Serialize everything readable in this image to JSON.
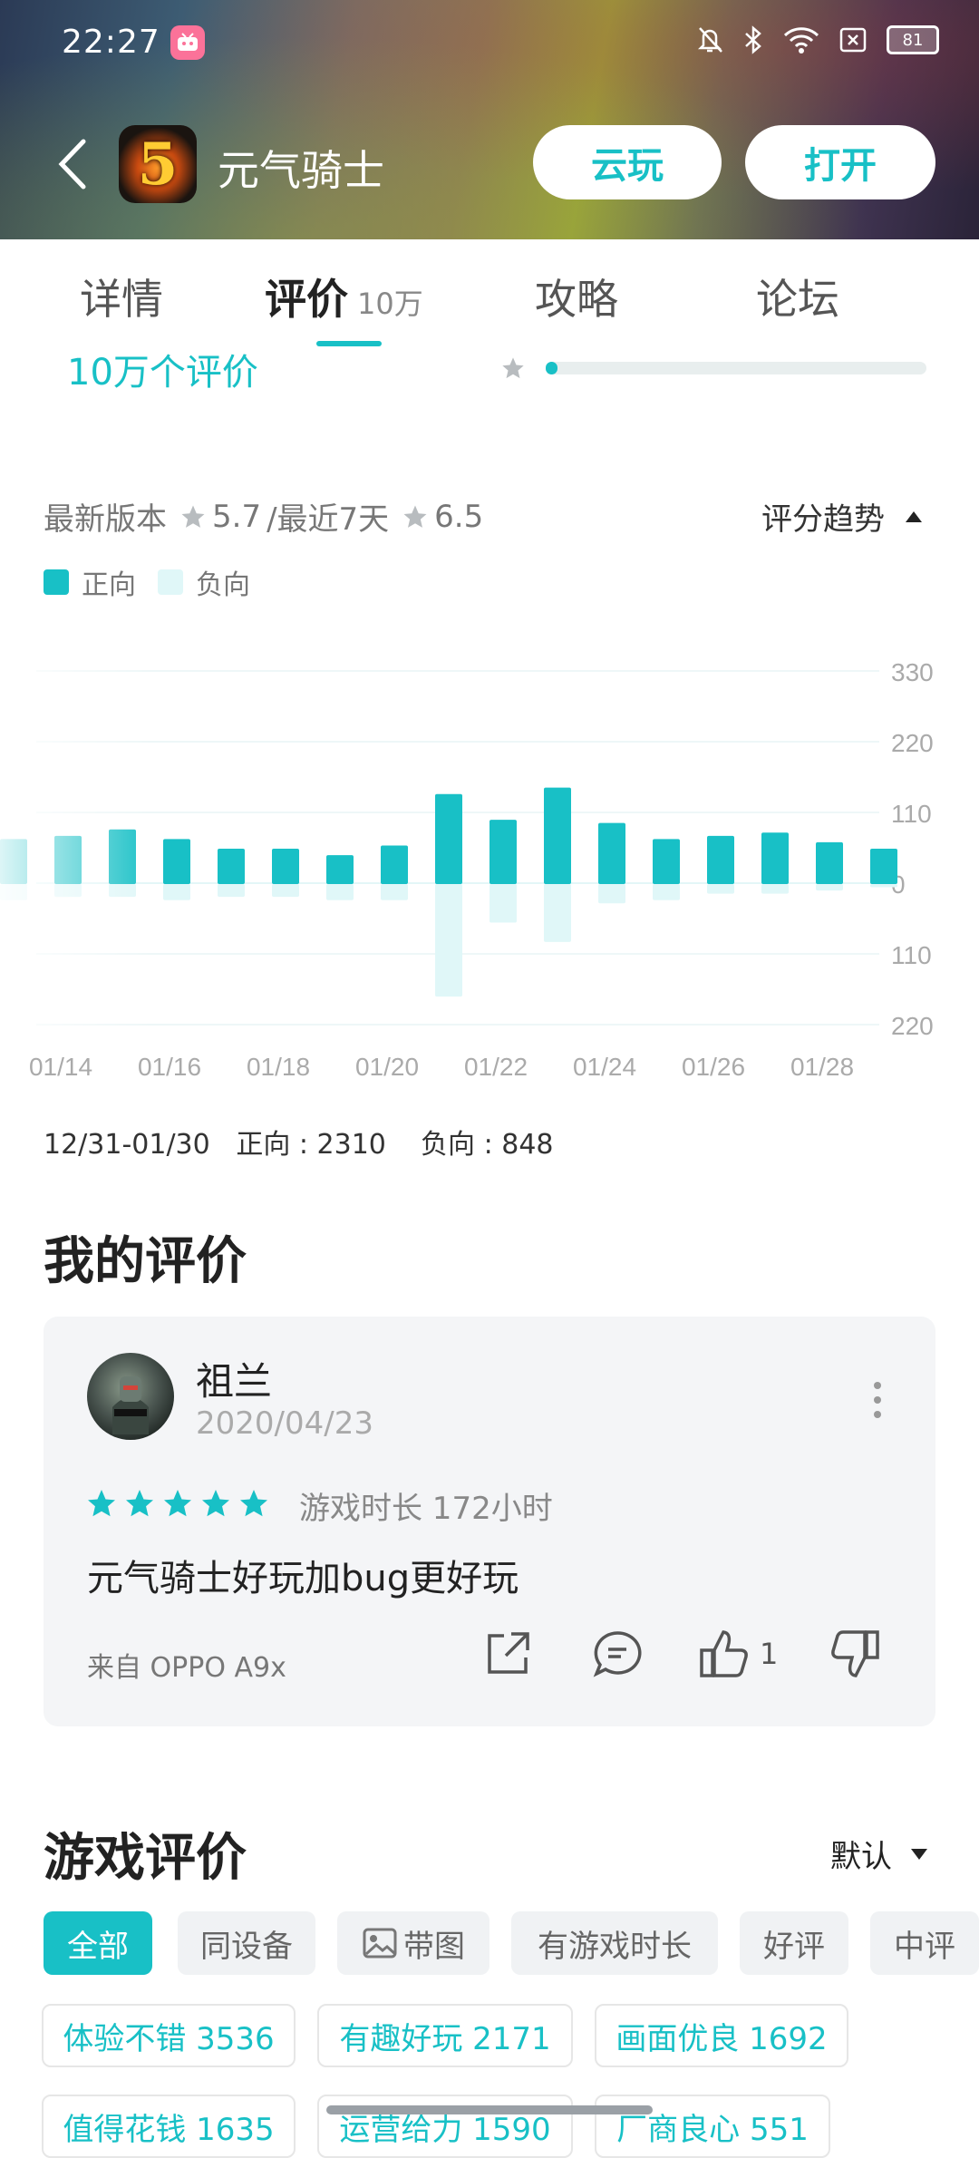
{
  "status": {
    "time": "22:27",
    "battery": "81"
  },
  "header": {
    "app_title": "元气骑士",
    "cloud_play": "云玩",
    "open": "打开",
    "icon_glyph": "5"
  },
  "tabs": [
    {
      "label": "详情"
    },
    {
      "label": "评价",
      "count": "10万"
    },
    {
      "label": "攻略"
    },
    {
      "label": "论坛"
    }
  ],
  "rating": {
    "count_text": "10万个评价",
    "bar_fill": 0.03
  },
  "version": {
    "latest_label": "最新版本",
    "latest_score": "5.7",
    "sep": "/最近7天",
    "recent_score": "6.5",
    "trend_label": "评分趋势"
  },
  "legend": {
    "positive": "正向",
    "negative": "负向"
  },
  "chart_data": {
    "type": "bar",
    "categories": [
      "01/13",
      "01/14",
      "01/15",
      "01/16",
      "01/17",
      "01/18",
      "01/19",
      "01/20",
      "01/21",
      "01/22",
      "01/23",
      "01/24",
      "01/25",
      "01/26",
      "01/27",
      "01/28",
      "01/29"
    ],
    "x_tick_labels": [
      "01/14",
      "01/16",
      "01/18",
      "01/20",
      "01/22",
      "01/24",
      "01/26",
      "01/28"
    ],
    "series": [
      {
        "name": "正向",
        "values": [
          70,
          75,
          85,
          70,
          55,
          55,
          45,
          60,
          140,
          100,
          150,
          95,
          70,
          75,
          80,
          65,
          55
        ]
      },
      {
        "name": "负向",
        "values": [
          25,
          20,
          20,
          25,
          20,
          20,
          25,
          25,
          175,
          60,
          90,
          30,
          25,
          15,
          15,
          10,
          5
        ]
      }
    ],
    "y_ticks": [
      "330",
      "220",
      "110",
      "0",
      "110",
      "220"
    ],
    "ylim": [
      -220,
      330
    ],
    "colors": {
      "positive": "#18c0c6",
      "negative": "#e0f7f8"
    }
  },
  "summary": {
    "range": "12/31-01/30",
    "pos_label": "正向 : 2310",
    "neg_label": "负向 : 848"
  },
  "my_review": {
    "section_title": "我的评价",
    "user": "祖兰",
    "date": "2020/04/23",
    "stars": 5,
    "playtime": "游戏时长 172小时",
    "text": "元气骑士好玩加bug更好玩",
    "device": "来自 OPPO A9x",
    "likes": "1"
  },
  "game_reviews": {
    "section_title": "游戏评价",
    "sort": "默认",
    "filters": [
      "全部",
      "同设备",
      "带图",
      "有游戏时长",
      "好评",
      "中评"
    ],
    "tags": [
      "体验不错 3536",
      "有趣好玩 2171",
      "画面优良 1692",
      "值得花钱 1635",
      "运营给力 1590",
      "厂商良心 551"
    ]
  }
}
